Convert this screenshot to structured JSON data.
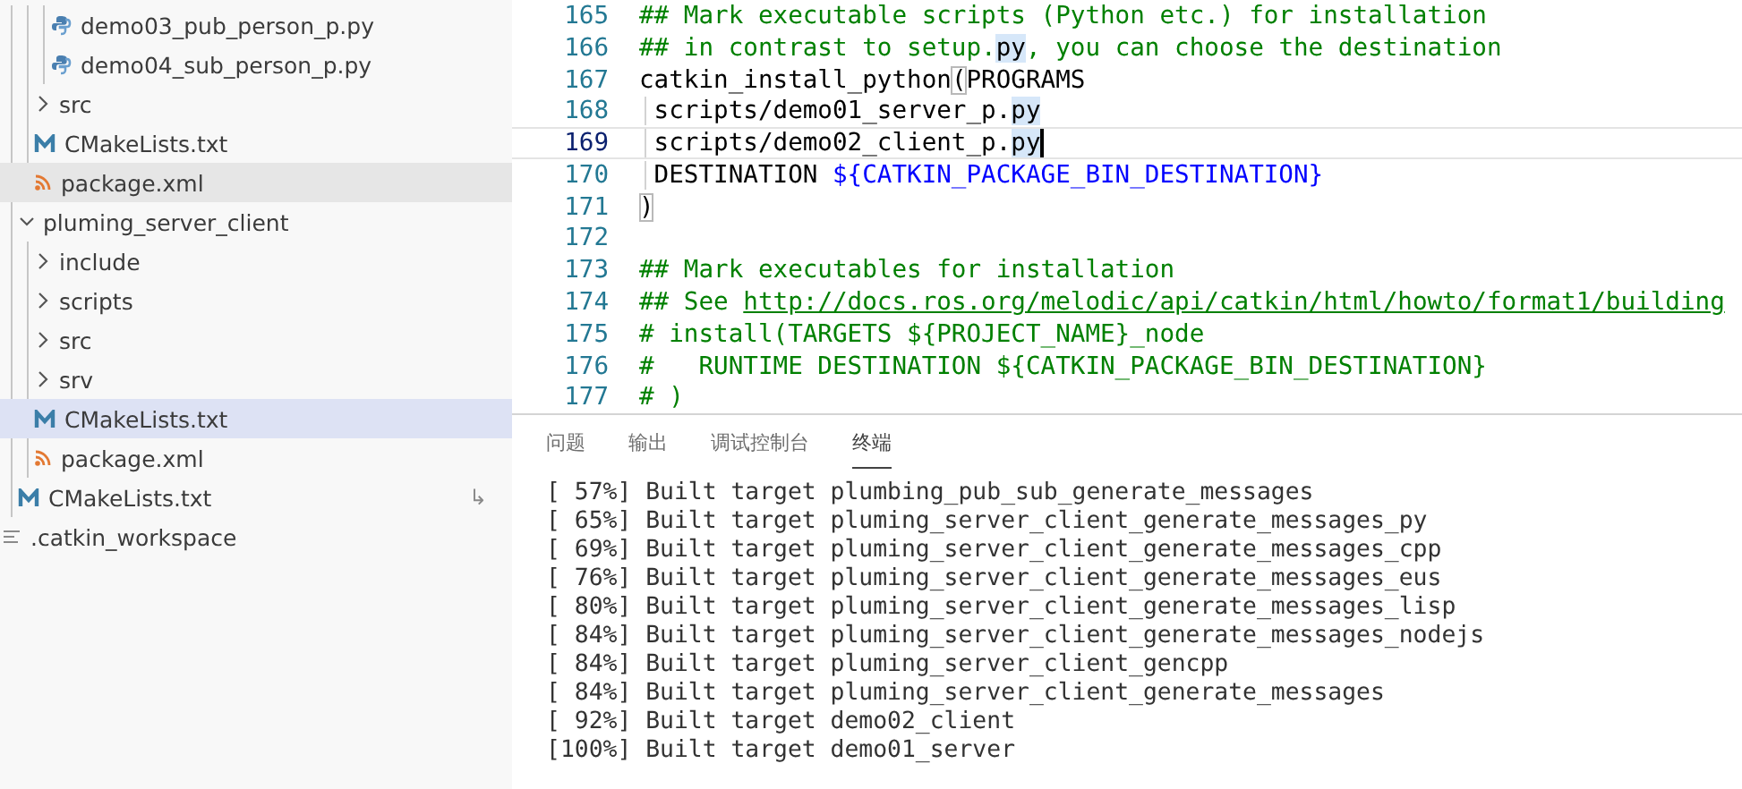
{
  "explorer": {
    "tree": [
      {
        "children": [
          {
            "children": [
              {
                "children": [
                  {
                    "label": "demo03_pub_person_p.py",
                    "kind": "python",
                    "selected": false,
                    "hovered": false
                  },
                  {
                    "label": "demo04_sub_person_p.py",
                    "kind": "python",
                    "selected": false,
                    "hovered": false
                  }
                ]
              },
              {
                "label": "src",
                "kind": "folder",
                "expanded": false,
                "selected": false,
                "hovered": false
              },
              {
                "label": "CMakeLists.txt",
                "kind": "cmake",
                "selected": false,
                "hovered": false
              },
              {
                "label": "package.xml",
                "kind": "xml",
                "selected": false,
                "hovered": true
              }
            ]
          },
          {
            "label": "pluming_server_client",
            "kind": "folder",
            "expanded": true,
            "selected": false,
            "hovered": false,
            "children": [
              {
                "label": "include",
                "kind": "folder",
                "expanded": false,
                "selected": false,
                "hovered": false
              },
              {
                "label": "scripts",
                "kind": "folder",
                "expanded": false,
                "selected": false,
                "hovered": false
              },
              {
                "label": "src",
                "kind": "folder",
                "expanded": false,
                "selected": false,
                "hovered": false
              },
              {
                "label": "srv",
                "kind": "folder",
                "expanded": false,
                "selected": false,
                "hovered": false
              },
              {
                "label": "CMakeLists.txt",
                "kind": "cmake",
                "selected": true,
                "hovered": false
              },
              {
                "label": "package.xml",
                "kind": "xml",
                "selected": false,
                "hovered": false
              }
            ]
          },
          {
            "label": "CMakeLists.txt",
            "kind": "cmake",
            "selected": false,
            "hovered": false,
            "decoration": "↳"
          }
        ]
      },
      {
        "label": ".catkin_workspace",
        "kind": "file",
        "selected": false,
        "hovered": false
      }
    ]
  },
  "editor": {
    "lines": [
      {
        "number": "165",
        "current": false,
        "indent_guide": false,
        "segments": [
          {
            "kind": "comment",
            "text": "## Mark executable scripts (Python etc.) for installation"
          }
        ]
      },
      {
        "number": "166",
        "current": false,
        "indent_guide": false,
        "segments": [
          {
            "kind": "comment",
            "text": "## in contrast to setup."
          },
          {
            "kind": "match",
            "text": "py"
          },
          {
            "kind": "comment",
            "text": ", you can choose the destination"
          }
        ]
      },
      {
        "number": "167",
        "current": false,
        "indent_guide": false,
        "segments": [
          {
            "kind": "plain",
            "text": "catkin_install_python"
          },
          {
            "kind": "bracket",
            "text": "("
          },
          {
            "kind": "plain",
            "text": "PROGRAMS"
          }
        ]
      },
      {
        "number": "168",
        "current": false,
        "indent_guide": true,
        "segments": [
          {
            "kind": "plain",
            "text": " scripts/demo01_server_p."
          },
          {
            "kind": "match",
            "text": "py"
          }
        ]
      },
      {
        "number": "169",
        "current": true,
        "indent_guide": true,
        "segments": [
          {
            "kind": "plain",
            "text": " scripts/demo02_client_p."
          },
          {
            "kind": "match",
            "text": "py"
          }
        ]
      },
      {
        "number": "170",
        "current": false,
        "indent_guide": true,
        "segments": [
          {
            "kind": "plain",
            "text": " DESTINATION "
          },
          {
            "kind": "var",
            "text": "${CATKIN_PACKAGE_BIN_DESTINATION}"
          }
        ]
      },
      {
        "number": "171",
        "current": false,
        "indent_guide": false,
        "segments": [
          {
            "kind": "bracket",
            "text": ")"
          }
        ]
      },
      {
        "number": "172",
        "current": false,
        "indent_guide": false
      },
      {
        "number": "173",
        "current": false,
        "indent_guide": false,
        "segments": [
          {
            "kind": "comment",
            "text": "## Mark executables for installation"
          }
        ]
      },
      {
        "number": "174",
        "current": false,
        "indent_guide": false,
        "segments": [
          {
            "kind": "comment",
            "text": "## See "
          },
          {
            "kind": "link",
            "text": "http://docs.ros.org/melodic/api/catkin/html/howto/format1/building"
          }
        ]
      },
      {
        "number": "175",
        "current": false,
        "indent_guide": false,
        "segments": [
          {
            "kind": "comment",
            "text": "# install(TARGETS ${PROJECT_NAME}_node"
          }
        ]
      },
      {
        "number": "176",
        "current": false,
        "indent_guide": false,
        "segments": [
          {
            "kind": "comment",
            "text": "#   RUNTIME DESTINATION ${CATKIN_PACKAGE_BIN_DESTINATION}"
          }
        ]
      },
      {
        "number": "177",
        "current": false,
        "indent_guide": false,
        "segments": [
          {
            "kind": "comment",
            "text": "# )"
          }
        ]
      }
    ]
  },
  "panel": {
    "tabs": [
      {
        "label": "问题",
        "selected": false
      },
      {
        "label": "输出",
        "selected": false
      },
      {
        "label": "调试控制台",
        "selected": false
      },
      {
        "label": "终端",
        "selected": true
      }
    ],
    "terminal_lines": [
      "[ 57%] Built target plumbing_pub_sub_generate_messages",
      "[ 65%] Built target pluming_server_client_generate_messages_py",
      "[ 69%] Built target pluming_server_client_generate_messages_cpp",
      "[ 76%] Built target pluming_server_client_generate_messages_eus",
      "[ 80%] Built target pluming_server_client_generate_messages_lisp",
      "[ 84%] Built target pluming_server_client_generate_messages_nodejs",
      "[ 84%] Built target pluming_server_client_gencpp",
      "[ 84%] Built target pluming_server_client_generate_messages",
      "[ 92%] Built target demo02_client",
      "[100%] Built target demo01_server"
    ]
  }
}
